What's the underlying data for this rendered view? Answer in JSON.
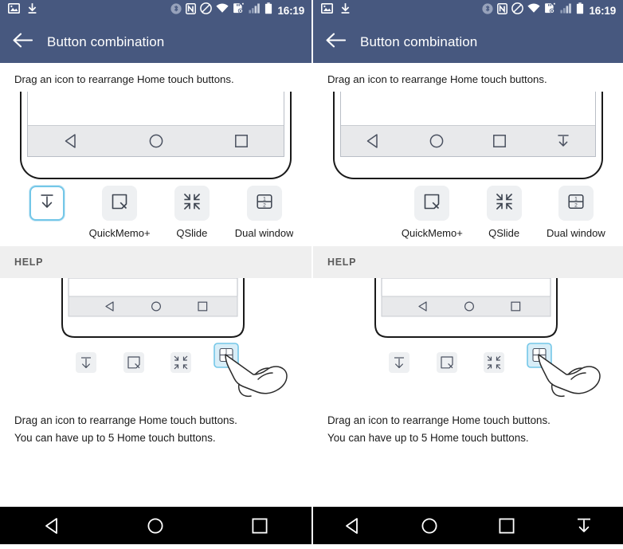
{
  "colors": {
    "header_bg": "#47587f",
    "status_bg": "#47587f",
    "accent_highlight": "#74c7e8",
    "tile_bg": "#eef0f2",
    "nav_strip_bg": "#e8e9eb",
    "help_bar_bg": "#efefef",
    "bottom_nav_bg": "#000000",
    "text_primary": "#1b1b1b",
    "text_secondary": "#5b5b5b"
  },
  "panels": [
    {
      "id": "before",
      "status_bar": {
        "time": "16:19",
        "left_icons": [
          "screenshot-image-icon",
          "download-icon"
        ],
        "right_icons": [
          "bluetooth-icon",
          "nfc-icon",
          "do-not-disturb-icon",
          "wifi-icon",
          "sd-card-error-icon",
          "signal-bars-icon",
          "battery-icon"
        ]
      },
      "app_bar": {
        "back_label": "back-arrow",
        "title": "Button combination"
      },
      "instruction": "Drag an icon to rearrange Home touch buttons.",
      "preview_nav_buttons": [
        "back-triangle-icon",
        "home-circle-icon",
        "recents-square-icon"
      ],
      "tray": [
        {
          "icon": "notification-pulldown-icon",
          "label": "",
          "selected": true,
          "empty": false
        },
        {
          "icon": "quickmemo-icon",
          "label": "QuickMemo+",
          "selected": false,
          "empty": false
        },
        {
          "icon": "qslide-icon",
          "label": "QSlide",
          "selected": false,
          "empty": false
        },
        {
          "icon": "dual-window-icon",
          "label": "Dual window",
          "selected": false,
          "empty": false
        }
      ],
      "help_header": "HELP",
      "help_illustration": {
        "nav_buttons": [
          "back-triangle-icon",
          "home-circle-icon",
          "recents-square-icon"
        ],
        "tray_icons": [
          "notification-pulldown-icon",
          "quickmemo-icon",
          "qslide-icon"
        ],
        "highlighted_icon": "dual-window-icon",
        "hand": "pointing-hand-icon"
      },
      "help_lines": [
        "Drag an icon to rearrange Home touch buttons.",
        "You can have up to 5 Home touch buttons."
      ],
      "bottom_nav": [
        "back-triangle-icon",
        "home-circle-icon",
        "recents-square-icon"
      ]
    },
    {
      "id": "after",
      "status_bar": {
        "time": "16:19",
        "left_icons": [
          "screenshot-image-icon",
          "download-icon"
        ],
        "right_icons": [
          "bluetooth-icon",
          "nfc-icon",
          "do-not-disturb-icon",
          "wifi-icon",
          "sd-card-error-icon",
          "signal-bars-icon",
          "battery-icon"
        ]
      },
      "app_bar": {
        "back_label": "back-arrow",
        "title": "Button combination"
      },
      "instruction": "Drag an icon to rearrange Home touch buttons.",
      "preview_nav_buttons": [
        "back-triangle-icon",
        "home-circle-icon",
        "recents-square-icon",
        "notification-pulldown-icon"
      ],
      "tray": [
        {
          "icon": "",
          "label": "",
          "selected": false,
          "empty": true
        },
        {
          "icon": "quickmemo-icon",
          "label": "QuickMemo+",
          "selected": false,
          "empty": false
        },
        {
          "icon": "qslide-icon",
          "label": "QSlide",
          "selected": false,
          "empty": false
        },
        {
          "icon": "dual-window-icon",
          "label": "Dual window",
          "selected": false,
          "empty": false
        }
      ],
      "help_header": "HELP",
      "help_illustration": {
        "nav_buttons": [
          "back-triangle-icon",
          "home-circle-icon",
          "recents-square-icon"
        ],
        "tray_icons": [
          "notification-pulldown-icon",
          "quickmemo-icon",
          "qslide-icon"
        ],
        "highlighted_icon": "dual-window-icon",
        "hand": "pointing-hand-icon"
      },
      "help_lines": [
        "Drag an icon to rearrange Home touch buttons.",
        "You can have up to 5 Home touch buttons."
      ],
      "bottom_nav": [
        "back-triangle-icon",
        "home-circle-icon",
        "recents-square-icon",
        "notification-pulldown-icon"
      ]
    }
  ]
}
